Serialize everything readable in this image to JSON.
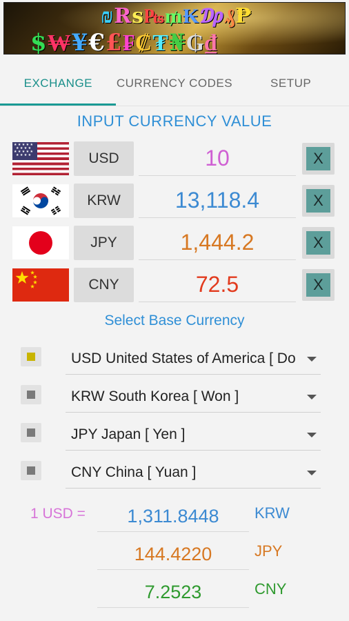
{
  "banner": {
    "row1_glyphs": [
      {
        "g": "₪",
        "color": "#3ad0ff"
      },
      {
        "g": "R",
        "color": "#ff66cc"
      },
      {
        "g": "s",
        "color": "#ffee55"
      },
      {
        "g": "₧",
        "color": "#ff4444"
      },
      {
        "g": "₥",
        "color": "#66ff66"
      },
      {
        "g": "₭",
        "color": "#5599ff"
      },
      {
        "g": "₯",
        "color": "#bb66ff"
      },
      {
        "g": "₰",
        "color": "#ff8844"
      },
      {
        "g": "₱",
        "color": "#ffdd33"
      }
    ],
    "row2_glyphs": [
      {
        "g": "$",
        "color": "#33dd55"
      },
      {
        "g": "₩",
        "color": "#ff3366"
      },
      {
        "g": "¥",
        "color": "#44aaff"
      },
      {
        "g": "€",
        "color": "#ffffff"
      },
      {
        "g": "£",
        "color": "#ff5555"
      },
      {
        "g": "₣",
        "color": "#ff44cc"
      },
      {
        "g": "₡",
        "color": "#ffcc33"
      },
      {
        "g": "₮",
        "color": "#55eeff"
      },
      {
        "g": "₦",
        "color": "#44cc44"
      },
      {
        "g": "₲",
        "color": "#dddddd"
      },
      {
        "g": "₫",
        "color": "#ff77aa"
      }
    ]
  },
  "tabs": [
    {
      "label": "EXCHANGE",
      "active": true
    },
    {
      "label": "CURRENCY CODES",
      "active": false
    },
    {
      "label": "SETUP",
      "active": false
    }
  ],
  "input_heading": "INPUT CURRENCY VALUE",
  "currencies": [
    {
      "flag": "usa-flag",
      "code": "USD",
      "value": "10",
      "color": "#cf5fd3"
    },
    {
      "flag": "south-korea-flag",
      "code": "KRW",
      "value": "13,118.4",
      "color": "#3c8ad2"
    },
    {
      "flag": "japan-flag",
      "code": "JPY",
      "value": "1,444.2",
      "color": "#d77822"
    },
    {
      "flag": "china-flag",
      "code": "CNY",
      "value": "72.5",
      "color": "#e23b1e"
    }
  ],
  "clear_label": "X",
  "base_heading": "Select Base Currency",
  "base_options": [
    {
      "label": "USD  United States of America [ Do",
      "selected": true
    },
    {
      "label": "KRW  South Korea [ Won ]",
      "selected": false
    },
    {
      "label": "JPY  Japan [ Yen ]",
      "selected": false
    },
    {
      "label": "CNY  China [ Yuan ]",
      "selected": false
    }
  ],
  "rate_base_label": "1 USD =",
  "rates": [
    {
      "value": "1,311.8448",
      "unit": "KRW",
      "color": "#3c8ad2",
      "unit_color": "#3c8ad2"
    },
    {
      "value": "144.4220",
      "unit": "JPY",
      "color": "#d77822",
      "unit_color": "#d77822"
    },
    {
      "value": "7.2523",
      "unit": "CNY",
      "color": "#2f9a2f",
      "unit_color": "#2f9a2f"
    }
  ]
}
